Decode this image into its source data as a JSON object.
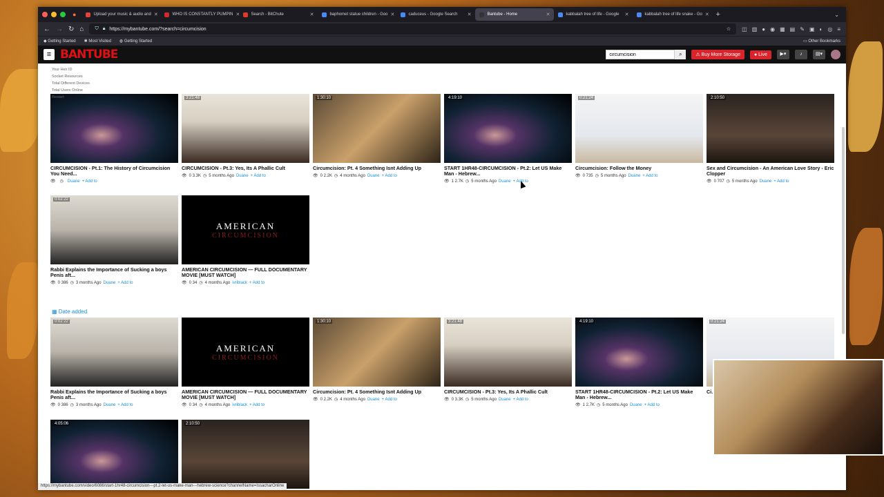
{
  "browser": {
    "tabs": [
      {
        "label": "Upload your music & audio and",
        "active": false,
        "color": "#e0433b"
      },
      {
        "label": "WHO IS CONSTANTLY PUMPIN",
        "active": false,
        "color": "#d02a2a"
      },
      {
        "label": "Search - BitChute",
        "active": false,
        "color": "#e23a28"
      },
      {
        "label": "baphomet statue children - Goo",
        "active": false,
        "color": "#4a8af4"
      },
      {
        "label": "caduceus - Google Search",
        "active": false,
        "color": "#4a8af4"
      },
      {
        "label": "Bantube - Home",
        "active": true,
        "color": "#333333"
      },
      {
        "label": "kabbalah tree of life - Google",
        "active": false,
        "color": "#4a8af4"
      },
      {
        "label": "kabbalah tree of life snake - Go",
        "active": false,
        "color": "#4a8af4"
      }
    ],
    "url": "https://mybantube.com/?search=circumcision",
    "bookmarks": [
      "Getting Started",
      "Most Visited",
      "Getting Started"
    ],
    "other_bookmarks": "Other Bookmarks",
    "status_url": "https://mybantube.com/video/6086/start-1hr48-circumcision---pt.2-let-us-make-man---hebrew-science?channelName=IssacharOnline"
  },
  "site": {
    "logo": "BANTUBE",
    "search_value": "circumcision",
    "buy_storage": "Buy More Storage",
    "live": "Live"
  },
  "section_label": "Date added",
  "row1": [
    {
      "title": "CIRCUMCISION - Pt.1: The History of Circumcision You Need...",
      "duration": "",
      "views": "",
      "age": "",
      "channel": "Duane",
      "thumb": "t-space"
    },
    {
      "title": "CIRCUMCISION - Pt.3: Yes, Its A Phallic Cult",
      "duration": "3:21:48",
      "views": "0  3.3K",
      "age": "5 months Ago",
      "channel": "Duane",
      "thumb": "t-man"
    },
    {
      "title": "Circumcision: Pt. 4 Something Isnt Adding Up",
      "duration": "1:30:10",
      "views": "0  2.2K",
      "age": "4 months Ago",
      "channel": "Duane",
      "thumb": "t-room"
    },
    {
      "title": "START 1HR48-CIRCUMCISION - Pt.2: Let US Make Man - Hebrew...",
      "duration": "4:19:10",
      "views": "1  2.7K",
      "age": "5 months Ago",
      "channel": "Duane",
      "thumb": "t-space"
    },
    {
      "title": "Circumcision: Follow the Money",
      "duration": "0:21:24",
      "views": "0  735",
      "age": "5 months Ago",
      "channel": "Duane",
      "thumb": "t-screen"
    },
    {
      "title": "Sex and Circumcision - An American Love Story - Eric Clopper",
      "duration": "2:10:50",
      "views": "0  707",
      "age": "5 months Ago",
      "channel": "Duane",
      "thumb": "t-stage"
    }
  ],
  "row2": [
    {
      "title": "Rabbi Explains the Importance of Sucking a boys Penis aft...",
      "duration": "0:02:22",
      "views": "0  386",
      "age": "3 months Ago",
      "channel": "Duane",
      "thumb": "t-rabbi"
    },
    {
      "title": "AMERICAN CIRCUMCISION — FULL DOCUMENTARY MOVIE [MUST WATCH]",
      "duration": "",
      "views": "0  34",
      "age": "4 months Ago",
      "channel": "ivriblack",
      "thumb": "t-black"
    }
  ],
  "row3": [
    {
      "title": "Rabbi Explains the Importance of Sucking a boys Penis aft...",
      "duration": "0:02:22",
      "views": "0  386",
      "age": "3 months Ago",
      "channel": "Duane",
      "thumb": "t-rabbi"
    },
    {
      "title": "AMERICAN CIRCUMCISION — FULL DOCUMENTARY MOVIE [MUST WATCH]",
      "duration": "",
      "views": "0  34",
      "age": "4 months Ago",
      "channel": "ivriblack",
      "thumb": "t-black"
    },
    {
      "title": "Circumcision: Pt. 4 Something Isnt Adding Up",
      "duration": "1:30:10",
      "views": "0  2.2K",
      "age": "4 months Ago",
      "channel": "Duane",
      "thumb": "t-room"
    },
    {
      "title": "CIRCUMCISION - Pt.3: Yes, Its A Phallic Cult",
      "duration": "3:21:48",
      "views": "0  3.3K",
      "age": "5 months Ago",
      "channel": "Duane",
      "thumb": "t-man"
    },
    {
      "title": "START 1HR48-CIRCUMCISION - Pt.2: Let US Make Man - Hebrew...",
      "duration": "4:19:10",
      "views": "1  2.7K",
      "age": "5 months Ago",
      "channel": "Duane",
      "thumb": "t-space"
    },
    {
      "title": "Ci...",
      "duration": "0:21:24",
      "views": "",
      "age": "",
      "channel": "",
      "thumb": "t-screen"
    }
  ],
  "row4": [
    {
      "title": "",
      "duration": "4:05:06",
      "thumb": "t-space"
    },
    {
      "title": "",
      "duration": "2:10:50",
      "thumb": "t-stage"
    }
  ],
  "black_thumb": {
    "line1": "AMERICAN",
    "line2": "CIRCUMCISION"
  },
  "add_label": "+ Add to",
  "overlay_items": [
    "Your Hex ID",
    "Socket Resources",
    "Total Different Devices",
    "Total Users Online",
    "Restart"
  ],
  "colors": {
    "accent": "#1a8fd6",
    "brand_red": "#d9242b"
  }
}
